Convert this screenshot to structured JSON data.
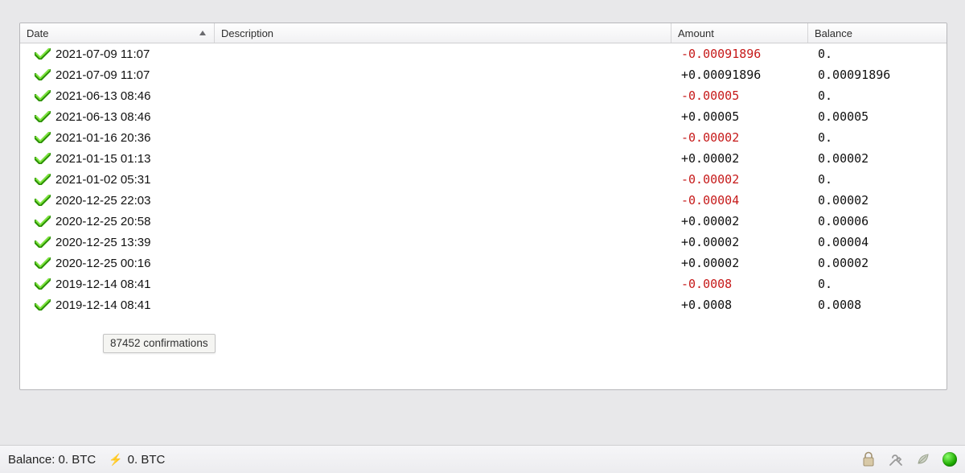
{
  "columns": {
    "date": "Date",
    "description": "Description",
    "amount": "Amount",
    "balance": "Balance",
    "sort_column": "date",
    "sort_direction": "asc"
  },
  "tooltip": "87452 confirmations",
  "statusbar": {
    "balance_label": "Balance:",
    "balance_value": "0. BTC",
    "lightning_value": "0. BTC"
  },
  "icons": {
    "status": "checkmark-icon",
    "lock": "lock-icon",
    "tools": "tools-icon",
    "seed": "seed-icon",
    "network": "network-status-icon"
  },
  "transactions": [
    {
      "date": "2021-07-09 11:07",
      "description": "",
      "amount": "-0.00091896",
      "amount_sign": "neg",
      "balance": "0."
    },
    {
      "date": "2021-07-09 11:07",
      "description": "",
      "amount": "+0.00091896",
      "amount_sign": "pos",
      "balance": "0.00091896"
    },
    {
      "date": "2021-06-13 08:46",
      "description": "",
      "amount": "-0.00005",
      "amount_sign": "neg",
      "balance": "0."
    },
    {
      "date": "2021-06-13 08:46",
      "description": "",
      "amount": "+0.00005",
      "amount_sign": "pos",
      "balance": "0.00005"
    },
    {
      "date": "2021-01-16 20:36",
      "description": "",
      "amount": "-0.00002",
      "amount_sign": "neg",
      "balance": "0."
    },
    {
      "date": "2021-01-15 01:13",
      "description": "",
      "amount": "+0.00002",
      "amount_sign": "pos",
      "balance": "0.00002"
    },
    {
      "date": "2021-01-02 05:31",
      "description": "",
      "amount": "-0.00002",
      "amount_sign": "neg",
      "balance": "0."
    },
    {
      "date": "2020-12-25 22:03",
      "description": "",
      "amount": "-0.00004",
      "amount_sign": "neg",
      "balance": "0.00002"
    },
    {
      "date": "2020-12-25 20:58",
      "description": "",
      "amount": "+0.00002",
      "amount_sign": "pos",
      "balance": "0.00006"
    },
    {
      "date": "2020-12-25 13:39",
      "description": "",
      "amount": "+0.00002",
      "amount_sign": "pos",
      "balance": "0.00004"
    },
    {
      "date": "2020-12-25 00:16",
      "description": "",
      "amount": "+0.00002",
      "amount_sign": "pos",
      "balance": "0.00002"
    },
    {
      "date": "2019-12-14 08:41",
      "description": "",
      "amount": "-0.0008",
      "amount_sign": "neg",
      "balance": "0."
    },
    {
      "date": "2019-12-14 08:41",
      "description": "",
      "amount": "+0.0008",
      "amount_sign": "pos",
      "balance": "0.0008"
    }
  ]
}
